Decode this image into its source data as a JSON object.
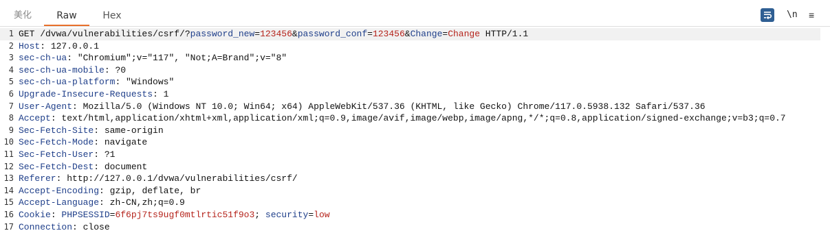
{
  "tabs": [
    {
      "label": "美化"
    },
    {
      "label": "Raw"
    },
    {
      "label": "Hex"
    }
  ],
  "toolbar": {
    "wrap_icon": "word-wrap-icon",
    "newline_label": "\\n",
    "menu_icon": "hamburger-menu-icon",
    "menu_glyph": "≡"
  },
  "colors": {
    "accent_underline": "#e8702a",
    "header_name": "#1f3f8a",
    "param_value": "#b5231b",
    "wrap_button": "#2f5f93"
  },
  "request": {
    "request_line": {
      "pre": "GET /dvwa/vulnerabilities/csrf/?",
      "params": [
        {
          "key": "password_new",
          "value": "123456"
        },
        {
          "key": "password_conf",
          "value": "123456"
        },
        {
          "key": "Change",
          "value": "Change"
        }
      ],
      "post": " HTTP/1.1"
    },
    "headers": [
      {
        "name": "Host",
        "value": "127.0.0.1"
      },
      {
        "name": "sec-ch-ua",
        "value": "\"Chromium\";v=\"117\", \"Not;A=Brand\";v=\"8\""
      },
      {
        "name": "sec-ch-ua-mobile",
        "value": "?0"
      },
      {
        "name": "sec-ch-ua-platform",
        "value": "\"Windows\""
      },
      {
        "name": "Upgrade-Insecure-Requests",
        "value": "1"
      },
      {
        "name": "User-Agent",
        "value": "Mozilla/5.0 (Windows NT 10.0; Win64; x64) AppleWebKit/537.36 (KHTML, like Gecko) Chrome/117.0.5938.132 Safari/537.36"
      },
      {
        "name": "Accept",
        "value": "text/html,application/xhtml+xml,application/xml;q=0.9,image/avif,image/webp,image/apng,*/*;q=0.8,application/signed-exchange;v=b3;q=0.7"
      },
      {
        "name": "Sec-Fetch-Site",
        "value": "same-origin"
      },
      {
        "name": "Sec-Fetch-Mode",
        "value": "navigate"
      },
      {
        "name": "Sec-Fetch-User",
        "value": "?1"
      },
      {
        "name": "Sec-Fetch-Dest",
        "value": "document"
      },
      {
        "name": "Referer",
        "value": "http://127.0.0.1/dvwa/vulnerabilities/csrf/"
      },
      {
        "name": "Accept-Encoding",
        "value": "gzip, deflate, br"
      },
      {
        "name": "Accept-Language",
        "value": "zh-CN,zh;q=0.9"
      },
      {
        "name": "Cookie",
        "cookies": [
          {
            "key": "PHPSESSID",
            "value": "6f6pj7ts9ugf0mtlrtic51f9o3"
          },
          {
            "key": "security",
            "value": "low"
          }
        ]
      },
      {
        "name": "Connection",
        "value": "close"
      }
    ]
  }
}
